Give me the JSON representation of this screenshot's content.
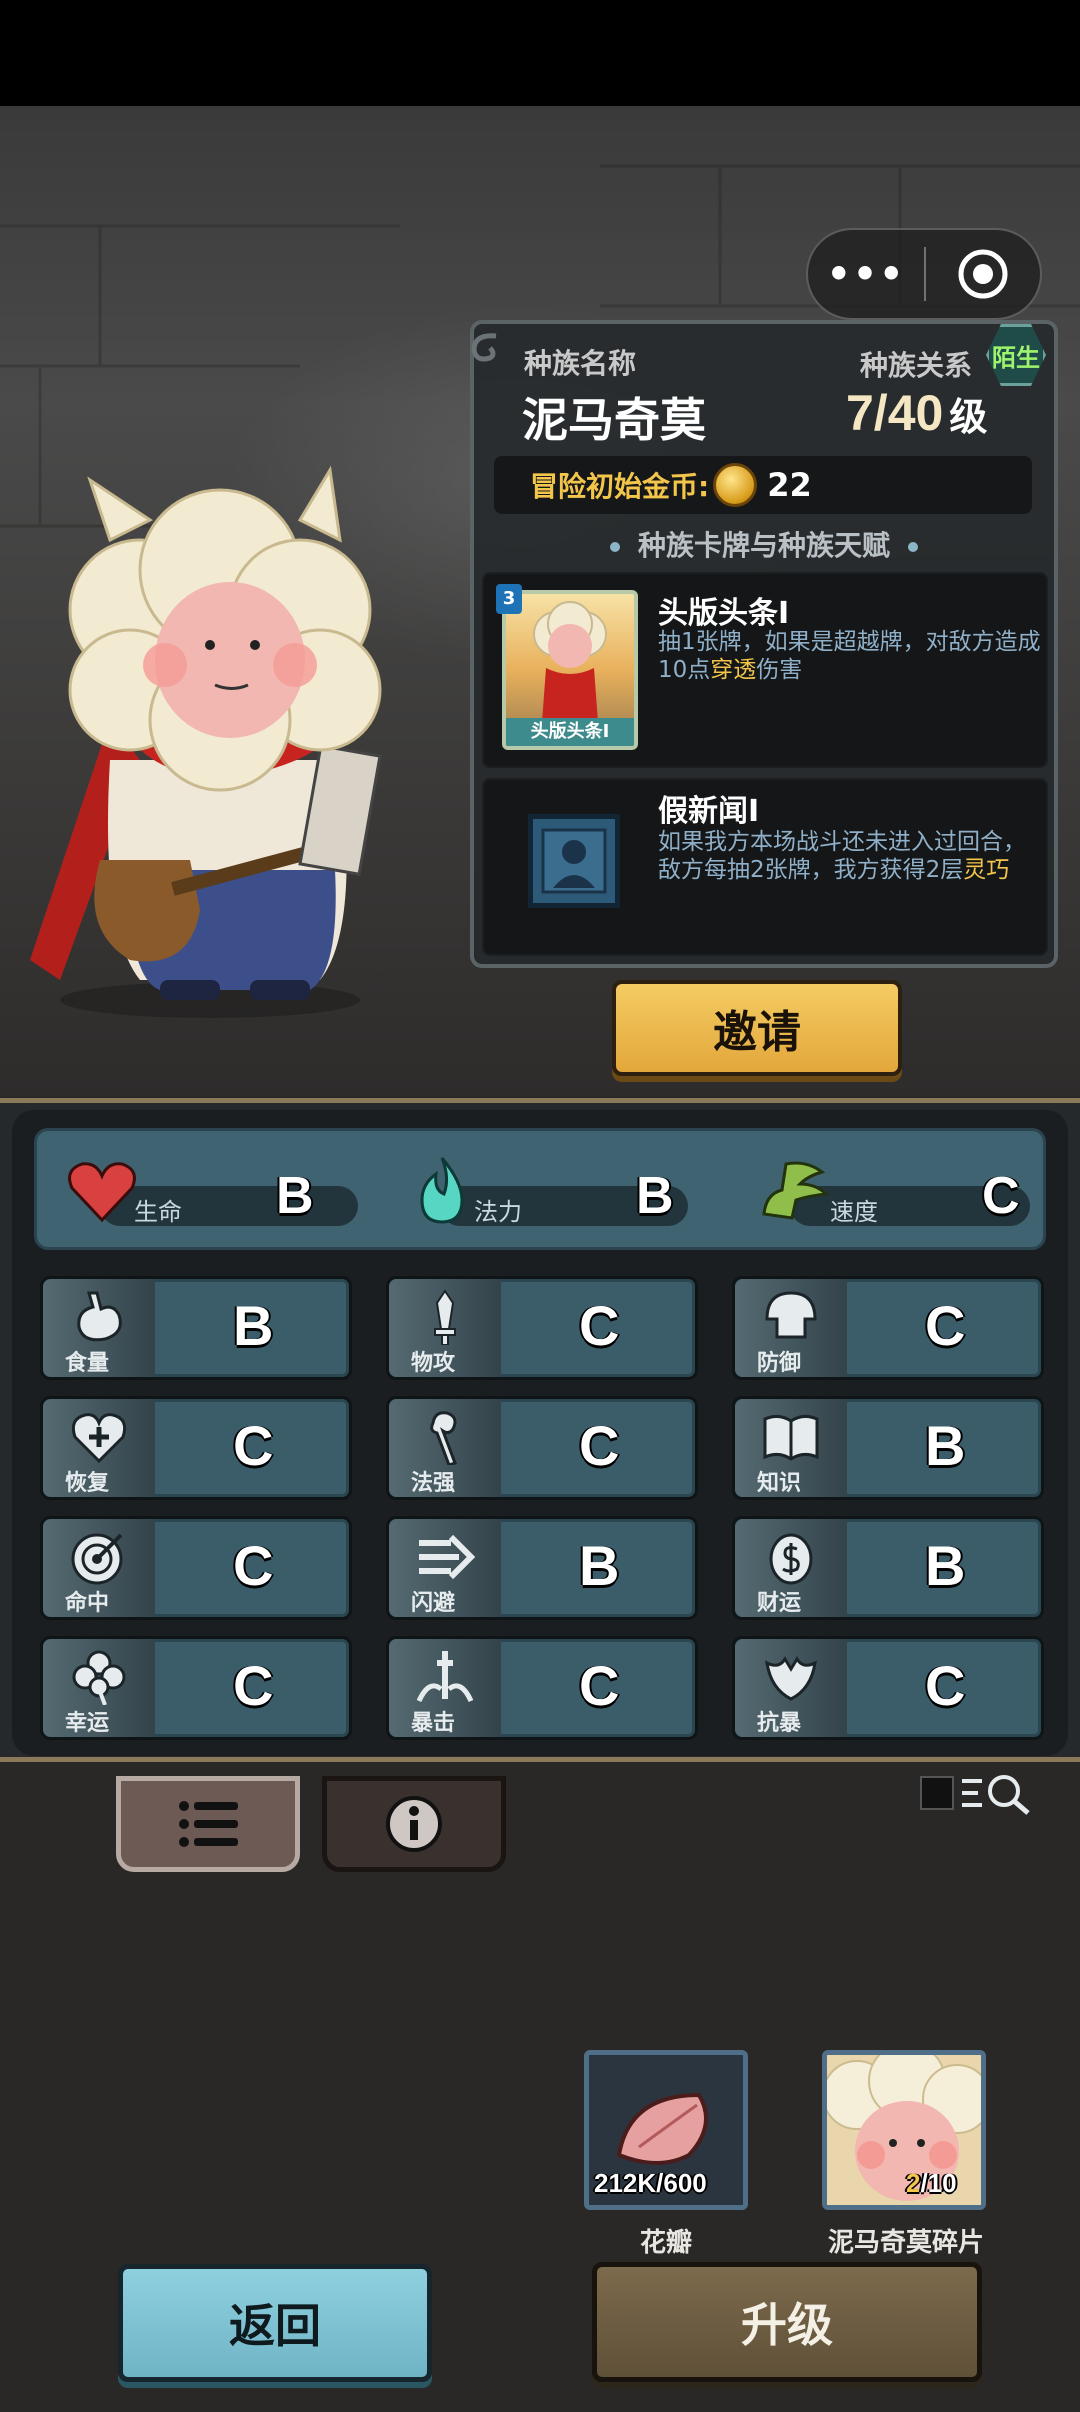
{
  "capsule": {
    "more_icon": "more-dots-icon",
    "close_icon": "target-circle-icon"
  },
  "race": {
    "name_label": "种族名称",
    "name": "泥马奇莫",
    "relation_label": "种族关系",
    "relation": "陌生",
    "level": "7/40",
    "level_unit": "级",
    "coin_label": "冒险初始金币:",
    "coin_value": "22",
    "section_title": "种族卡牌与种族天赋"
  },
  "cards": [
    {
      "level": "3",
      "caption": "头版头条I",
      "title": "头版头条I",
      "desc_a": "抽1张牌，如果是超越牌，对敌方造成10点",
      "desc_hl": "穿透",
      "desc_b": "伤害"
    },
    {
      "title": "假新闻I",
      "desc_a": "如果我方本场战斗还未进入过回合，敌方每抽2张牌，我方获得2层",
      "desc_hl": "灵巧",
      "desc_b": ""
    }
  ],
  "invite_label": "邀请",
  "top_stats": [
    {
      "label": "生命",
      "grade": "B",
      "icon": "heart-icon",
      "color": "#d94040"
    },
    {
      "label": "法力",
      "grade": "B",
      "icon": "mana-flame-icon",
      "color": "#57d6c3"
    },
    {
      "label": "速度",
      "grade": "C",
      "icon": "wing-boot-icon",
      "color": "#8fbf4a"
    }
  ],
  "stats": [
    {
      "label": "食量",
      "grade": "B",
      "icon": "stomach-icon"
    },
    {
      "label": "物攻",
      "grade": "C",
      "icon": "sword-icon"
    },
    {
      "label": "防御",
      "grade": "C",
      "icon": "helmet-icon"
    },
    {
      "label": "恢复",
      "grade": "C",
      "icon": "heart-plus-icon"
    },
    {
      "label": "法强",
      "grade": "C",
      "icon": "staff-icon"
    },
    {
      "label": "知识",
      "grade": "B",
      "icon": "book-icon"
    },
    {
      "label": "命中",
      "grade": "C",
      "icon": "target-icon"
    },
    {
      "label": "闪避",
      "grade": "B",
      "icon": "dash-arrow-icon"
    },
    {
      "label": "财运",
      "grade": "B",
      "icon": "coin-icon"
    },
    {
      "label": "幸运",
      "grade": "C",
      "icon": "clover-icon"
    },
    {
      "label": "暴击",
      "grade": "C",
      "icon": "crit-sword-icon"
    },
    {
      "label": "抗暴",
      "grade": "C",
      "icon": "shield-burst-icon"
    }
  ],
  "items": [
    {
      "name": "花瓣",
      "count": "212K/600",
      "icon": "petal-icon"
    },
    {
      "name": "泥马奇莫碎片",
      "count_have": "2",
      "count_need": "/10",
      "icon": "character-portrait"
    }
  ],
  "buttons": {
    "back": "返回",
    "upgrade": "升级"
  }
}
